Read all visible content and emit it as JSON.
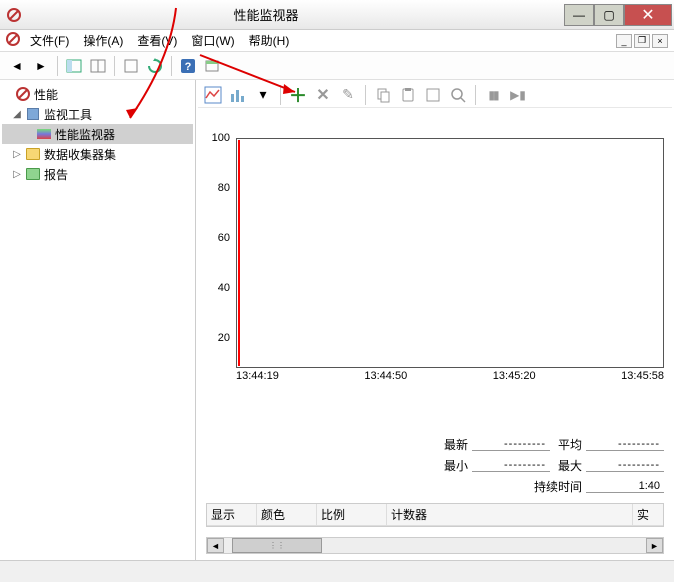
{
  "window": {
    "title": "性能监视器"
  },
  "menus": {
    "file": "文件(F)",
    "action": "操作(A)",
    "view": "查看(V)",
    "window": "窗口(W)",
    "help": "帮助(H)"
  },
  "tree": {
    "root": "性能",
    "monitoring": "监视工具",
    "perfmon": "性能监视器",
    "datacollector": "数据收集器集",
    "reports": "报告"
  },
  "chart_data": {
    "type": "line",
    "title": "",
    "xlabel": "",
    "ylabel": "",
    "ylim": [
      0,
      100
    ],
    "yticks": [
      20,
      40,
      60,
      80,
      100
    ],
    "x_ticks": [
      "13:44:19",
      "13:44:50",
      "13:45:20",
      "13:45:58"
    ],
    "series": [],
    "cursor_x": "13:44:19"
  },
  "stats": {
    "latest_label": "最新",
    "latest_val": "---------",
    "avg_label": "平均",
    "avg_val": "---------",
    "min_label": "最小",
    "min_val": "---------",
    "max_label": "最大",
    "max_val": "---------",
    "duration_label": "持续时间",
    "duration_val": "1:40"
  },
  "grid": {
    "cols": {
      "show": "显示",
      "color": "颜色",
      "scale": "比例",
      "counter": "计数器",
      "inst": "实"
    }
  }
}
